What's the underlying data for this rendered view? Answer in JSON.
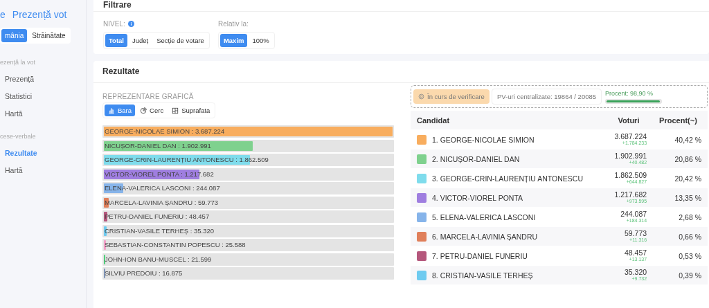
{
  "sidebar": {
    "logo": "e",
    "title": "Prezență vot",
    "scope_options": [
      {
        "label": "mânia",
        "selected": true
      },
      {
        "label": "Străinătate",
        "selected": false
      }
    ],
    "sections": [
      {
        "heading": "ezență la vot",
        "items": [
          {
            "label": "Prezență",
            "selected": false
          },
          {
            "label": "Statistici",
            "selected": false
          },
          {
            "label": "Hartă",
            "selected": false
          }
        ]
      },
      {
        "heading": "cese-verbale",
        "items": [
          {
            "label": "Rezultate",
            "selected": true
          },
          {
            "label": "Hartă",
            "selected": false
          }
        ]
      }
    ]
  },
  "filter": {
    "title": "Filtrare",
    "groups": [
      {
        "label": "NIVEL:",
        "info": true,
        "options": [
          {
            "label": "Total",
            "selected": true
          },
          {
            "label": "Județ",
            "selected": false
          },
          {
            "label": "Secție de votare",
            "selected": false
          }
        ]
      },
      {
        "label": "Relativ la:",
        "info": false,
        "options": [
          {
            "label": "Maxim",
            "selected": true
          },
          {
            "label": "100%",
            "selected": false
          }
        ]
      }
    ]
  },
  "results": {
    "title": "Rezultate",
    "chart_label": "REPREZENTARE GRAFICĂ",
    "chart_types": [
      {
        "kind": "bar",
        "label": "Bara",
        "selected": true
      },
      {
        "kind": "pie",
        "label": "Cerc",
        "selected": false
      },
      {
        "kind": "area",
        "label": "Suprafata",
        "selected": false
      }
    ],
    "bars": [
      {
        "label": "GEORGE-NICOLAE SIMION : 3.687.224",
        "level": 1,
        "color": "#f8ad5e"
      },
      {
        "label": "NICUȘOR-DANIEL DAN : 1.902.991",
        "level": 0.516,
        "color": "#7fd18e"
      },
      {
        "label": "GEORGE-CRIN-LAURENȚIU ANTONESCU : 1.862.509",
        "level": 0.505,
        "color": "#7fdcec"
      },
      {
        "label": "VICTOR-VIOREL PONTA : 1.217.682",
        "level": 0.33,
        "color": "#9f7ee0"
      },
      {
        "label": "ELENA-VALERICA LASCONI : 244.087",
        "level": 0.066,
        "color": "#86b4ea"
      },
      {
        "label": "MARCELA-LAVINIA ȘANDRU : 59.773",
        "level": 0.016,
        "color": "#e07f5a"
      },
      {
        "label": "PETRU-DANIEL FUNERIU : 48.457",
        "level": 0.013,
        "color": "#b5577c"
      },
      {
        "label": "CRISTIAN-VASILE TERHEȘ : 35.320",
        "level": 0.0096,
        "color": "#6ecbf0"
      },
      {
        "label": "SEBASTIAN-CONSTANTIN POPESCU : 25.588",
        "level": 0.0069,
        "color": "#f2a0c8"
      },
      {
        "label": "JOHN-ION BANU-MUSCEL : 21.599",
        "level": 0.0059,
        "color": "#4fd07a"
      },
      {
        "label": "SILVIU PREDOIU : 16.875",
        "level": 0.0046,
        "color": "#7f95b8"
      }
    ],
    "status": {
      "badge": "În curs de verificare",
      "counted": "PV-uri centralizate: 19864 / 20085",
      "percent_label": "Procent: 98,90 %",
      "level": 0.989
    },
    "table": {
      "columns": [
        "Candidat",
        "Voturi",
        "Procent(~)"
      ],
      "rows": [
        {
          "color": "#f8ad5e",
          "name": "1. GEORGE-NICOLAE SIMION",
          "votes": "3.687.224",
          "delta": "+1.784.233",
          "percent": "40,42 %"
        },
        {
          "color": "#7fd18e",
          "name": "2. NICUȘOR-DANIEL DAN",
          "votes": "1.902.991",
          "delta": "+40.482",
          "percent": "20,86 %"
        },
        {
          "color": "#7fdcec",
          "name": "3. GEORGE-CRIN-LAURENȚIU ANTONESCU",
          "votes": "1.862.509",
          "delta": "+644.827",
          "percent": "20,42 %"
        },
        {
          "color": "#9f7ee0",
          "name": "4. VICTOR-VIOREL PONTA",
          "votes": "1.217.682",
          "delta": "+973.595",
          "percent": "13,35 %"
        },
        {
          "color": "#86b4ea",
          "name": "5. ELENA-VALERICA LASCONI",
          "votes": "244.087",
          "delta": "+184.314",
          "percent": "2,68 %"
        },
        {
          "color": "#e07f5a",
          "name": "6. MARCELA-LAVINIA ȘANDRU",
          "votes": "59.773",
          "delta": "+11.316",
          "percent": "0,66 %"
        },
        {
          "color": "#b5577c",
          "name": "7. PETRU-DANIEL FUNERIU",
          "votes": "48.457",
          "delta": "+13.137",
          "percent": "0,53 %"
        },
        {
          "color": "#6ecbf0",
          "name": "8. CRISTIAN-VASILE TERHEȘ",
          "votes": "35.320",
          "delta": "+9.732",
          "percent": "0,39 %"
        }
      ]
    }
  }
}
